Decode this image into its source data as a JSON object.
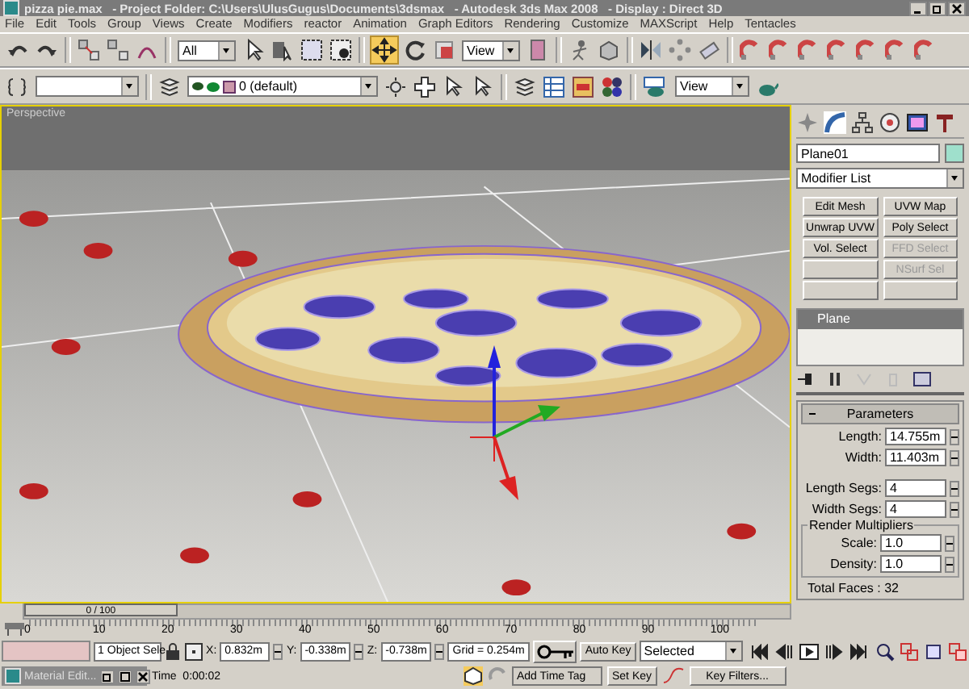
{
  "window": {
    "title": "pizza pie.max   - Project Folder: C:\\Users\\UlusGugus\\Documents\\3dsmax   - Autodesk 3ds Max 2008   - Display : Direct 3D"
  },
  "menu": [
    "File",
    "Edit",
    "Tools",
    "Group",
    "Views",
    "Create",
    "Modifiers",
    "reactor",
    "Animation",
    "Graph Editors",
    "Rendering",
    "Customize",
    "MAXScript",
    "Help",
    "Tentacles"
  ],
  "main_toolbar": {
    "selection_filter": "All",
    "reference_coordinate": "View",
    "move_selected": true
  },
  "second_toolbar": {
    "layer": "0 (default)",
    "render_view": "View"
  },
  "viewport": {
    "label": "Perspective"
  },
  "command_panel": {
    "object_name": "Plane01",
    "modifier_list": "Modifier List",
    "modifier_buttons": [
      {
        "label": "Edit Mesh",
        "disabled": false
      },
      {
        "label": "UVW Map",
        "disabled": false
      },
      {
        "label": "Unwrap UVW",
        "disabled": false
      },
      {
        "label": "Poly Select",
        "disabled": false
      },
      {
        "label": "Vol. Select",
        "disabled": false
      },
      {
        "label": "FFD Select",
        "disabled": true
      },
      {
        "label": "NSurf Sel",
        "disabled": true
      }
    ],
    "stack": [
      {
        "label": "Plane",
        "selected": true
      }
    ],
    "rollout": {
      "title": "Parameters",
      "fields": [
        {
          "label": "Length:",
          "value": "14.755m"
        },
        {
          "label": "Width:",
          "value": "11.403m"
        },
        {
          "label": "Length Segs:",
          "value": "4"
        },
        {
          "label": "Width Segs:",
          "value": "4"
        }
      ],
      "group": {
        "title": "Render Multipliers",
        "fields": [
          {
            "label": "Scale:",
            "value": "1.0"
          },
          {
            "label": "Density:",
            "value": "1.0"
          }
        ]
      },
      "total": "Total Faces : 32"
    }
  },
  "time_slider": {
    "label": "0 / 100",
    "level": 0
  },
  "ruler": [
    "0",
    "10",
    "20",
    "30",
    "40",
    "50",
    "60",
    "70",
    "80",
    "90",
    "100"
  ],
  "status": {
    "selection": "1 Object Sele",
    "coords": [
      {
        "axis": "X:",
        "value": "0.832m"
      },
      {
        "axis": "Y:",
        "value": "-0.338m"
      },
      {
        "axis": "Z:",
        "value": "-0.738m"
      }
    ],
    "grid": "Grid = 0.254m",
    "auto_key": "Auto Key",
    "key_mode": "Selected",
    "set_key": "Set Key",
    "key_filters": "Key Filters...",
    "time": "Time  0:00:02",
    "add_time_tag": "Add Time Tag"
  },
  "taskbar_window": {
    "title": "Material Edit..."
  }
}
